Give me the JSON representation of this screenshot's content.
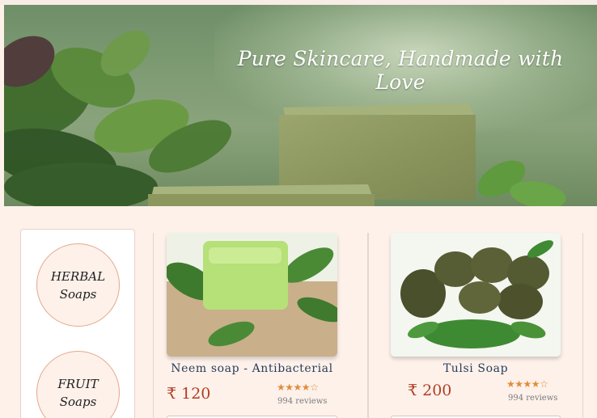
{
  "hero": {
    "title": "Pure Skincare, Handmade with Love"
  },
  "sidebar": {
    "categories": [
      {
        "line1": "HERBAL",
        "line2": "Soaps"
      },
      {
        "line1": "FRUIT",
        "line2": "Soaps"
      }
    ]
  },
  "products": [
    {
      "name": "Neem soap - Antibacterial",
      "price": "₹ 120",
      "rating": 4,
      "reviews": "994 reviews"
    },
    {
      "name": "Tulsi Soap",
      "price": "₹ 200",
      "rating": 4,
      "reviews": "994 reviews"
    }
  ],
  "colors": {
    "accent": "#e08c3a",
    "price": "#b23d22",
    "background": "#fdf1ea"
  }
}
